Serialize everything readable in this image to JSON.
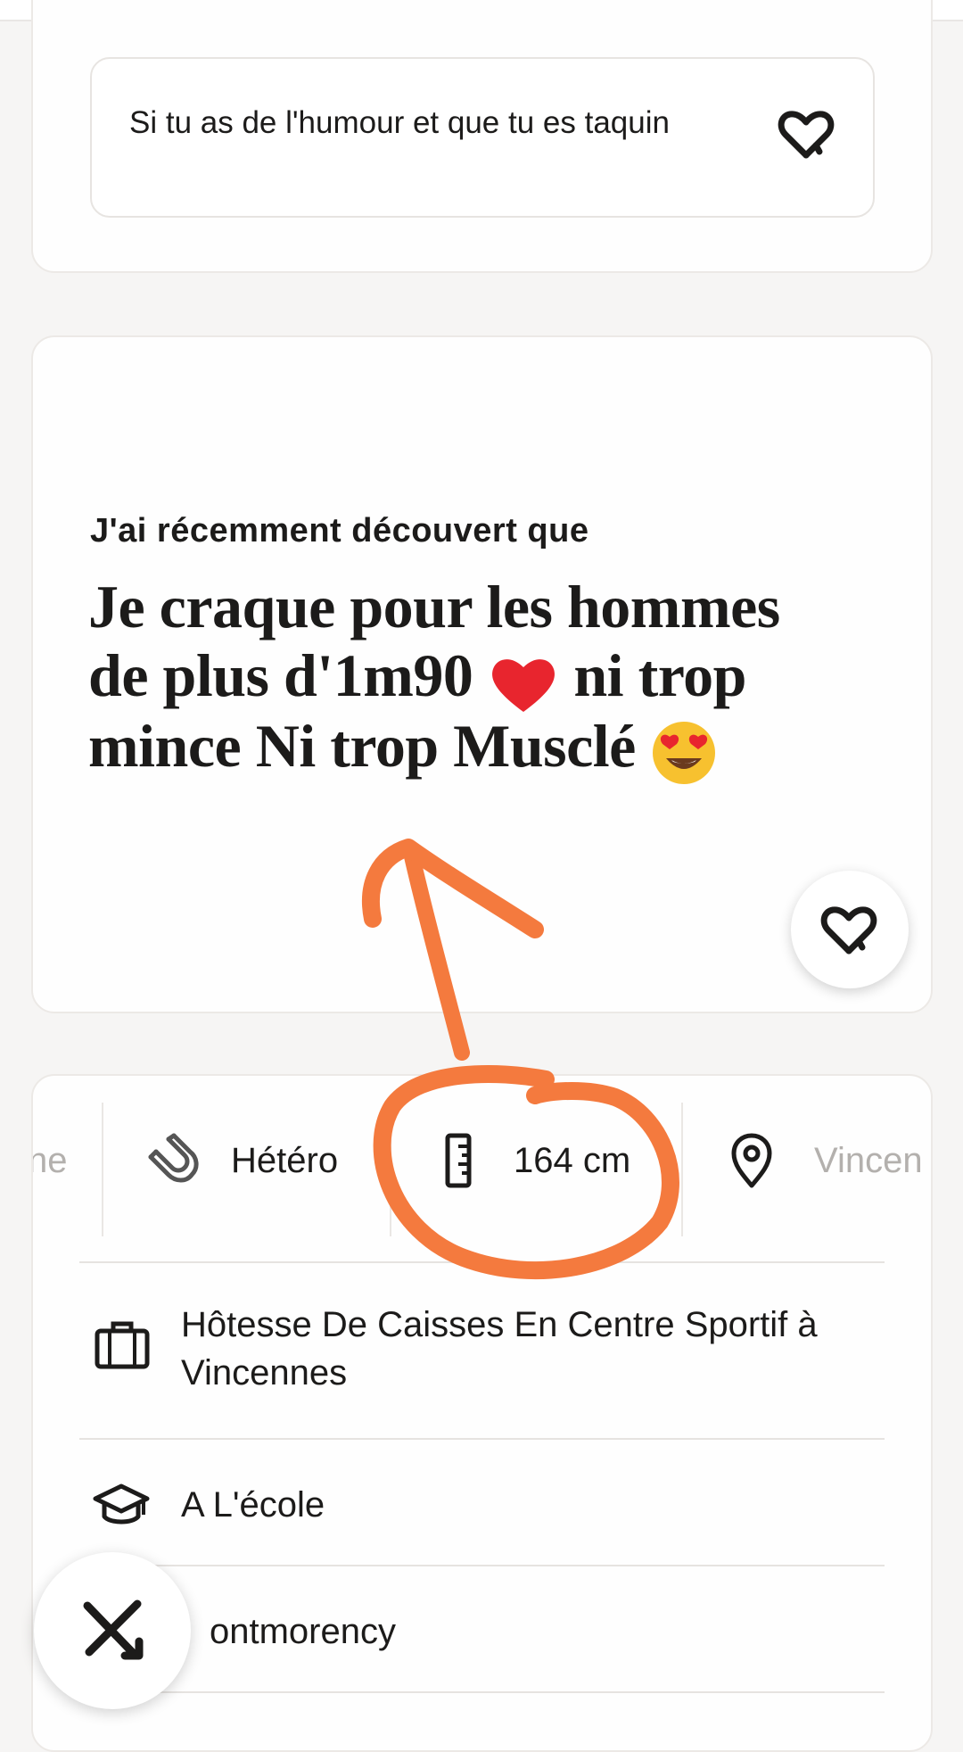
{
  "prompt_card_1": {
    "answer": "Si tu as de l'humour et que tu es taquin",
    "like_icon": "heart-icon"
  },
  "prompt_card_2": {
    "question": "J'ai récemment découvert que",
    "answer_line1": "Je craque pour les hommes",
    "answer_line2": "de plus d'1m90",
    "answer_line2_emoji": "❤️",
    "answer_line2_end": "ni trop",
    "answer_line3": "mince Ni trop Musclé",
    "answer_line3_emoji": "😍",
    "like_icon": "heart-icon"
  },
  "vitals": {
    "cut_left": "ne",
    "orientation": "Hétéro",
    "orientation_icon": "magnet-icon",
    "height": "164 cm",
    "height_icon": "ruler-icon",
    "location": "Vincen",
    "location_icon": "location-pin-icon"
  },
  "details": {
    "job": "Hôtesse De Caisses En Centre Sportif  à Vincennes",
    "job_icon": "briefcase-icon",
    "school": "A L'école",
    "school_icon": "graduation-cap-icon",
    "hometown": "ontmorency"
  },
  "pass_button": {
    "icon": "close-icon"
  },
  "colors": {
    "accent_annotation": "#F47A3E",
    "text": "#1C1B1A",
    "muted": "#B3B0AD",
    "card": "#FEFEFE",
    "background": "#F6F5F4"
  }
}
